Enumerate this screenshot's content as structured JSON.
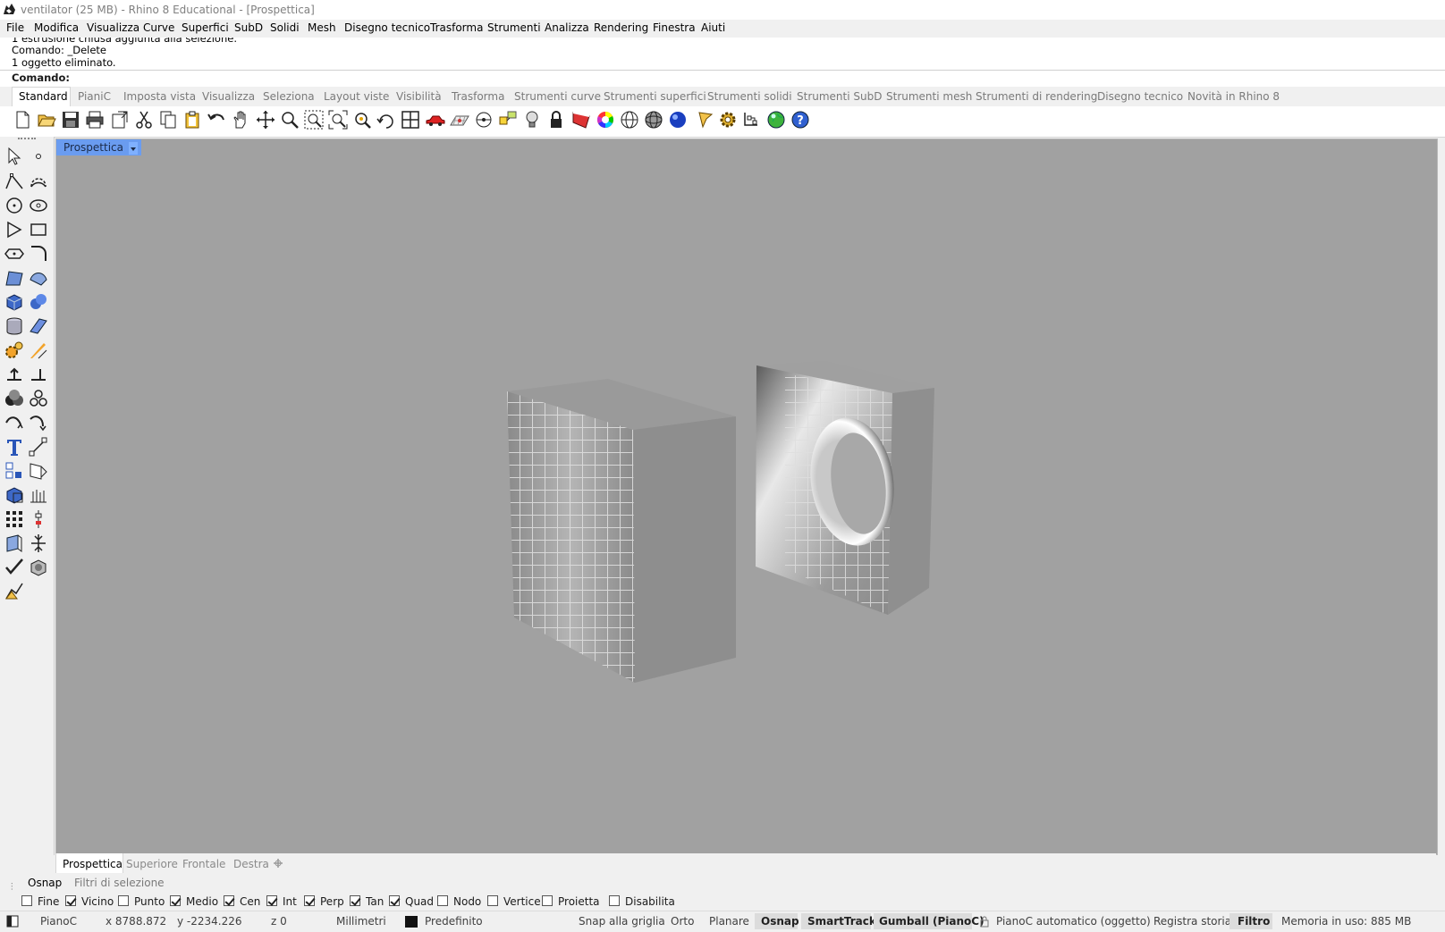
{
  "window": {
    "title": "ventilator (25 MB) - Rhino 8 Educational - [Prospettica]"
  },
  "menu": [
    "File",
    "Modifica",
    "Visualizza",
    "Curve",
    "Superfici",
    "SubD",
    "Solidi",
    "Mesh",
    "Disegno tecnico",
    "Trasforma",
    "Strumenti",
    "Analizza",
    "Rendering",
    "Finestra",
    "Aiuti"
  ],
  "command": {
    "history": [
      "1 estrusione chiusa aggiunta alla selezione.",
      "Comando: _Delete",
      "1 oggetto eliminato."
    ],
    "prompt_label": "Comando:"
  },
  "toolbar_tabs": [
    "Standard",
    "PianiC",
    "Imposta vista",
    "Visualizza",
    "Seleziona",
    "Layout viste",
    "Visibilità",
    "Trasforma",
    "Strumenti curve",
    "Strumenti superfici",
    "Strumenti solidi",
    "Strumenti SubD",
    "Strumenti mesh",
    "Strumenti di rendering",
    "Disegno tecnico",
    "Novità in Rhino 8"
  ],
  "toolbar_icons": [
    "new-icon",
    "open-icon",
    "save-icon",
    "print-icon",
    "export-icon",
    "cut-icon",
    "copy-icon",
    "paste-icon",
    "undo-icon",
    "pan-hand-icon",
    "rotate-view-icon",
    "zoom-icon",
    "zoom-window-icon",
    "zoom-extents-icon",
    "zoom-selected-icon",
    "rotate-icon",
    "four-viewports-icon",
    "car-icon",
    "grid-icon",
    "circle-snap-icon",
    "layers-icon",
    "light-bulb-icon",
    "lock-icon",
    "material-icon",
    "color-wheel-icon",
    "wireframe-sphere-icon",
    "shaded-sphere-icon",
    "rendered-sphere-icon",
    "pen-icon",
    "gear-icon",
    "options-icon",
    "globe-icon",
    "help-icon"
  ],
  "viewport": {
    "label": "Prospettica"
  },
  "view_tabs": [
    "Prospettica",
    "Superiore",
    "Frontale",
    "Destra"
  ],
  "osnap_tabs": [
    "Osnap",
    "Filtri di selezione"
  ],
  "osnaps": [
    {
      "label": "Fine",
      "checked": false
    },
    {
      "label": "Vicino",
      "checked": true
    },
    {
      "label": "Punto",
      "checked": false
    },
    {
      "label": "Medio",
      "checked": true
    },
    {
      "label": "Cen",
      "checked": true
    },
    {
      "label": "Int",
      "checked": true
    },
    {
      "label": "Perp",
      "checked": true
    },
    {
      "label": "Tan",
      "checked": true
    },
    {
      "label": "Quad",
      "checked": true
    },
    {
      "label": "Nodo",
      "checked": false
    },
    {
      "label": "Vertice",
      "checked": false
    },
    {
      "label": "Proietta",
      "checked": false
    },
    {
      "label": "Disabilita",
      "checked": false
    }
  ],
  "status": {
    "cplane": "PianoC",
    "x": "x 8788.872",
    "y": "y -2234.226",
    "z": "z 0",
    "units": "Millimetri",
    "layer": "Predefinito",
    "snap_grid": "Snap alla griglia",
    "ortho": "Orto",
    "planar": "Planare",
    "osnap": "Osnap",
    "smarttrack": "SmartTrack",
    "gumball": "Gumball (PianoC)",
    "auto_cplane": "PianoC automatico (oggetto)",
    "record_history": "Registra storia",
    "filter": "Filtro",
    "memory": "Memoria in uso: 885 MB",
    "side_tab": "Osn..."
  },
  "colors": {
    "viewport_bg": "#a1a1a1",
    "active_view_label": "#6a9cf0",
    "model_gray": "#8f8f8f"
  }
}
